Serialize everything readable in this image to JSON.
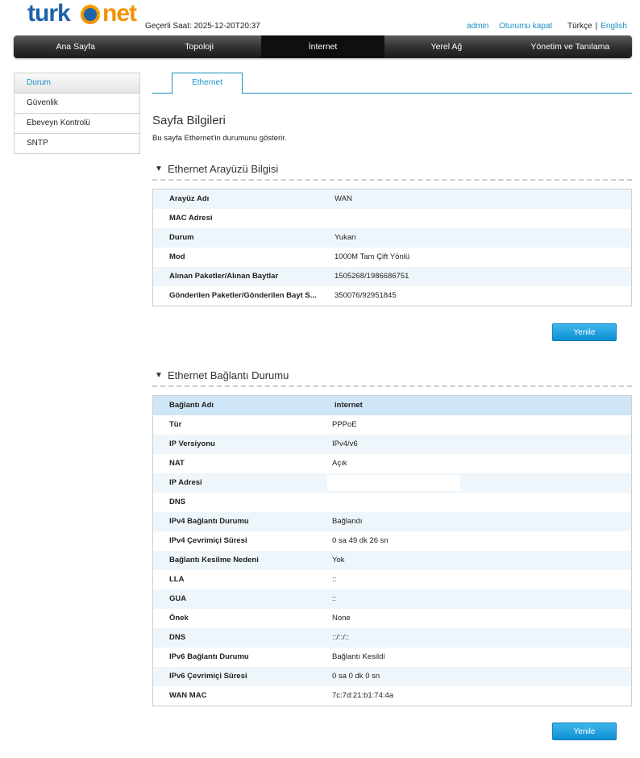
{
  "brand": {
    "left": "turk",
    "right": "net"
  },
  "header": {
    "clock": "Geçerli Saat: 2025-12-20T20:37",
    "user": "admin",
    "logout": "Oturumu kapat",
    "lang_current": "Türkçe",
    "lang_sep": "|",
    "lang_other": "English"
  },
  "nav": [
    "Ana Sayfa",
    "Topoloji",
    "İnternet",
    "Yerel Ağ",
    "Yönetim ve Tanılama"
  ],
  "nav_active": 2,
  "sidebar": [
    "Durum",
    "Güvenlik",
    "Ebeveyn Kontrolü",
    "SNTP"
  ],
  "tab": "Ethernet",
  "page": {
    "title": "Sayfa Bilgileri",
    "desc": "Bu sayfa Ethernet'in durumunu gösterir."
  },
  "section1": {
    "title": "Ethernet Arayüzü Bilgisi",
    "rows": [
      [
        "Arayüz Adı",
        "WAN"
      ],
      [
        "MAC Adresi",
        ""
      ],
      [
        "Durum",
        "Yukarı"
      ],
      [
        "Mod",
        "1000M Tam Çift Yönlü"
      ],
      [
        "Alınan Paketler/Alınan Baytlar",
        "1505268/1986686751"
      ],
      [
        "Gönderilen Paketler/Gönderilen Bayt S...",
        "350076/92951845"
      ]
    ],
    "button": "Yenile"
  },
  "section2": {
    "title": "Ethernet Bağlantı Durumu",
    "rows": [
      [
        "Bağlantı Adı",
        "internet"
      ],
      [
        "Tür",
        "PPPoE"
      ],
      [
        "IP Versiyonu",
        "IPv4/v6"
      ],
      [
        "NAT",
        "Açık"
      ],
      [
        "IP Adresi",
        ""
      ],
      [
        "DNS",
        ""
      ],
      [
        "IPv4 Bağlantı Durumu",
        "Bağlandı"
      ],
      [
        "IPv4 Çevrimiçi Süresi",
        "0 sa 49 dk 26 sn"
      ],
      [
        "Bağlantı Kesilme Nedeni",
        "Yok"
      ],
      [
        "LLA",
        "::"
      ],
      [
        "GUA",
        "::"
      ],
      [
        "Önek",
        "None"
      ],
      [
        "DNS",
        "::/::/::"
      ],
      [
        "IPv6 Bağlantı Durumu",
        "Bağlantı Kesildi"
      ],
      [
        "IPv6 Çevrimiçi Süresi",
        "0 sa 0 dk 0 sn"
      ],
      [
        "WAN MAC",
        "7c:7d:21:b1:74:4a"
      ]
    ],
    "button": "Yenile"
  }
}
